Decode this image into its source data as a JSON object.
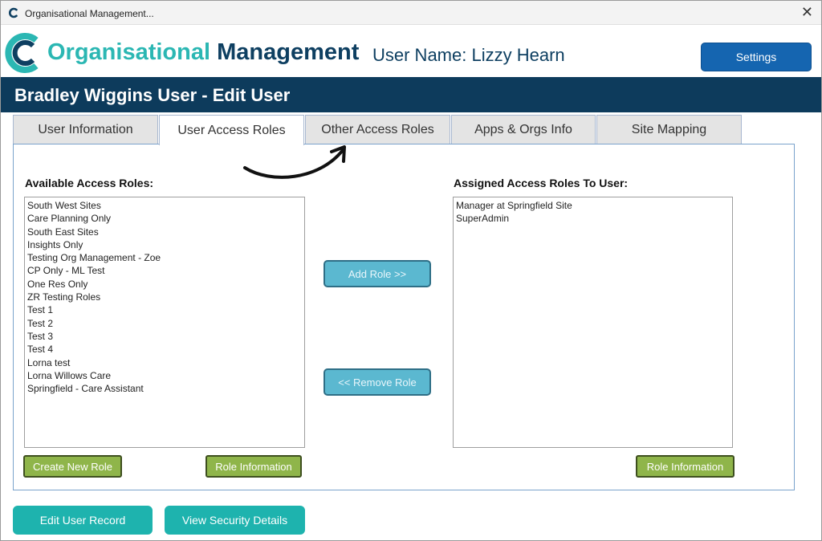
{
  "window": {
    "title": "Organisational Management..."
  },
  "brand": {
    "part1": "Organisational",
    "part2": "Management"
  },
  "user": {
    "label": "User Name: Lizzy Hearn"
  },
  "settings_label": "Settings",
  "page": {
    "title": "Bradley Wiggins User - Edit User"
  },
  "tabs": [
    {
      "label": "User Information",
      "active": false
    },
    {
      "label": "User Access Roles",
      "active": true
    },
    {
      "label": "Other Access Roles",
      "active": false
    },
    {
      "label": "Apps & Orgs Info",
      "active": false
    },
    {
      "label": "Site Mapping",
      "active": false
    }
  ],
  "available": {
    "label": "Available Access Roles:",
    "items": [
      "South West Sites",
      "Care Planning Only",
      "South East Sites",
      "Insights Only",
      "Testing Org Management - Zoe",
      "CP Only - ML Test",
      "One Res Only",
      "ZR Testing Roles",
      "Test 1",
      "Test 2",
      "Test 3",
      "Test 4",
      "Lorna test",
      "Lorna Willows Care",
      "Springfield - Care Assistant"
    ],
    "create_label": "Create New Role",
    "info_label": "Role Information"
  },
  "assigned": {
    "label": "Assigned Access Roles To User:",
    "items": [
      "Manager at Springfield Site",
      "SuperAdmin"
    ],
    "info_label": "Role Information"
  },
  "actions": {
    "add_label": "Add Role >>",
    "remove_label": "<< Remove Role"
  },
  "footer": {
    "edit_label": "Edit User Record",
    "security_label": "View Security Details"
  },
  "colors": {
    "brand_teal": "#2bb7b3",
    "brand_navy": "#0e3f61",
    "header_bg": "#0d3b5c",
    "settings_bg": "#1565b0",
    "green_btn": "#8fb54a",
    "teal_btn": "#1eb3ae"
  }
}
